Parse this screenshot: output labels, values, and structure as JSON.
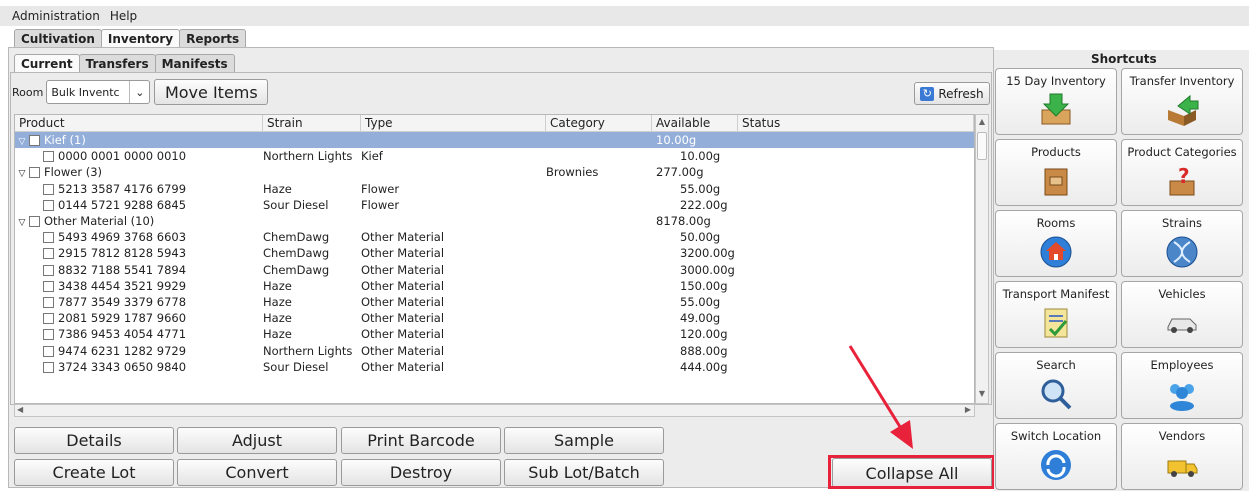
{
  "menu": {
    "items": [
      "Administration",
      "Help"
    ]
  },
  "main_tabs": [
    "Cultivation",
    "Inventory",
    "Reports"
  ],
  "sub_tabs": [
    "Current",
    "Transfers",
    "Manifests"
  ],
  "toolbar": {
    "room_label": "Room",
    "room_value": "Bulk Inventc",
    "move_label": "Move Items",
    "refresh_label": "Refresh"
  },
  "table": {
    "columns": [
      "Product",
      "Strain",
      "Type",
      "Category",
      "Available",
      "Status"
    ],
    "rows": [
      {
        "product": "Kief (1)",
        "strain": "",
        "type": "",
        "category": "",
        "available": "10.00g",
        "group": true,
        "selected": true
      },
      {
        "product": "0000 0001 0000 0010",
        "strain": "Northern Lights",
        "type": "Kief",
        "category": "",
        "available": "10.00g",
        "group": false
      },
      {
        "product": "Flower (3)",
        "strain": "",
        "type": "",
        "category": "Brownies",
        "available": "277.00g",
        "group": true
      },
      {
        "product": "5213 3587 4176 6799",
        "strain": "Haze",
        "type": "Flower",
        "category": "",
        "available": "55.00g",
        "group": false
      },
      {
        "product": "0144 5721 9288 6845",
        "strain": "Sour Diesel",
        "type": "Flower",
        "category": "",
        "available": "222.00g",
        "group": false
      },
      {
        "product": "Other Material (10)",
        "strain": "",
        "type": "",
        "category": "",
        "available": "8178.00g",
        "group": true
      },
      {
        "product": "5493 4969 3768 6603",
        "strain": "ChemDawg",
        "type": "Other Material",
        "category": "",
        "available": "50.00g",
        "group": false
      },
      {
        "product": "2915 7812 8128 5943",
        "strain": "ChemDawg",
        "type": "Other Material",
        "category": "",
        "available": "3200.00g",
        "group": false
      },
      {
        "product": "8832 7188 5541 7894",
        "strain": "ChemDawg",
        "type": "Other Material",
        "category": "",
        "available": "3000.00g",
        "group": false
      },
      {
        "product": "3438 4454 3521 9929",
        "strain": "Haze",
        "type": "Other Material",
        "category": "",
        "available": "150.00g",
        "group": false
      },
      {
        "product": "7877 3549 3379 6778",
        "strain": "Haze",
        "type": "Other Material",
        "category": "",
        "available": "55.00g",
        "group": false
      },
      {
        "product": "2081 5929 1787 9660",
        "strain": "Haze",
        "type": "Other Material",
        "category": "",
        "available": "49.00g",
        "group": false
      },
      {
        "product": "7386 9453 4054 4771",
        "strain": "Haze",
        "type": "Other Material",
        "category": "",
        "available": "120.00g",
        "group": false
      },
      {
        "product": "9474 6231 1282 9729",
        "strain": "Northern Lights",
        "type": "Other Material",
        "category": "",
        "available": "888.00g",
        "group": false
      },
      {
        "product": "3724 3343 0650 9840",
        "strain": "Sour Diesel",
        "type": "Other Material",
        "category": "",
        "available": "444.00g",
        "group": false
      }
    ]
  },
  "actions": {
    "details": "Details",
    "adjust": "Adjust",
    "print_barcode": "Print Barcode",
    "sample": "Sample",
    "create_lot": "Create Lot",
    "convert": "Convert",
    "destroy": "Destroy",
    "sub_lot": "Sub Lot/Batch",
    "collapse_all": "Collapse All"
  },
  "shortcuts": {
    "title": "Shortcuts",
    "items": [
      "15 Day Inventory",
      "Transfer Inventory",
      "Products",
      "Product Categories",
      "Rooms",
      "Strains",
      "Transport Manifest",
      "Vehicles",
      "Search",
      "Employees",
      "Switch Location",
      "Vendors"
    ]
  },
  "colors": {
    "selection": "#92aed9",
    "highlight": "#e8223a"
  }
}
